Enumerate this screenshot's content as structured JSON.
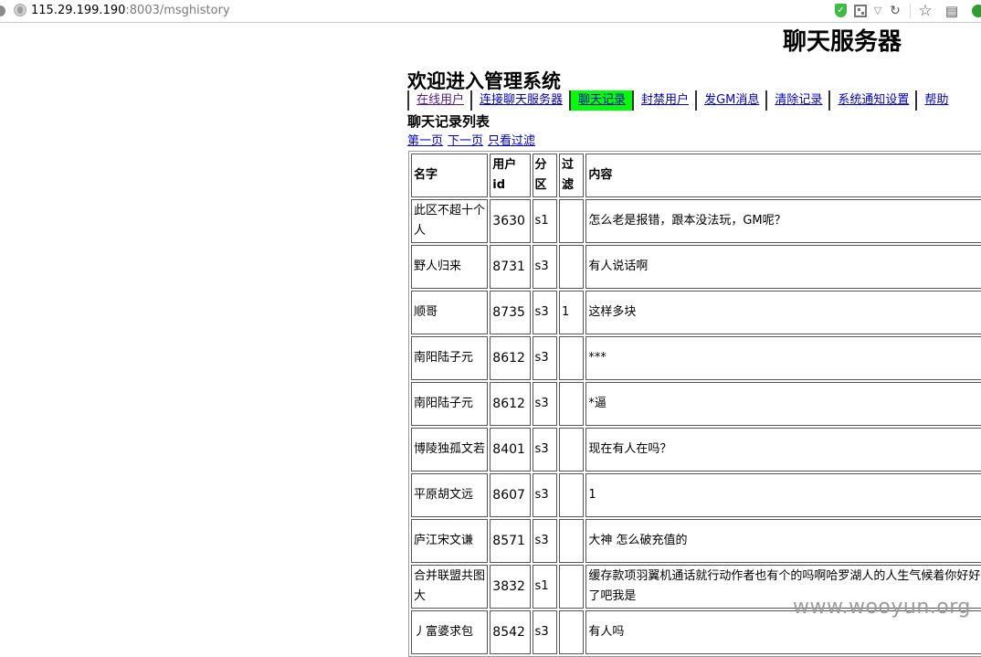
{
  "browser": {
    "url_host": "115.29.199.190",
    "url_path": ":8003/msghistory"
  },
  "page": {
    "server_title": "聊天服务器",
    "welcome": "欢迎进入管理系统",
    "list_title": "聊天记录列表"
  },
  "nav": [
    {
      "label": "在线用户",
      "name": "nav-online-users",
      "state": "visited"
    },
    {
      "label": "连接聊天服务器",
      "name": "nav-connect-server",
      "state": ""
    },
    {
      "label": "聊天记录",
      "name": "nav-chat-history",
      "state": "active"
    },
    {
      "label": "封禁用户",
      "name": "nav-ban-user",
      "state": ""
    },
    {
      "label": "发GM消息",
      "name": "nav-send-gm",
      "state": ""
    },
    {
      "label": "清除记录",
      "name": "nav-clear-records",
      "state": ""
    },
    {
      "label": "系统通知设置",
      "name": "nav-notify-settings",
      "state": ""
    },
    {
      "label": "帮助",
      "name": "nav-help",
      "state": ""
    }
  ],
  "pager": {
    "first": "第一页",
    "next": "下一页",
    "filtered_only": "只看过滤"
  },
  "table": {
    "headers": [
      "名字",
      "用户id",
      "分区",
      "过滤",
      "内容"
    ],
    "rows": [
      {
        "name": "此区不超十个人",
        "uid": "3630",
        "zone": "s1",
        "filter": "",
        "content": "怎么老是报错，跟本没法玩，GM呢？"
      },
      {
        "name": "野人归来",
        "uid": "8731",
        "zone": "s3",
        "filter": "",
        "content": "有人说话啊"
      },
      {
        "name": "顺哥",
        "uid": "8735",
        "zone": "s3",
        "filter": "1",
        "content": "这样多块"
      },
      {
        "name": "南阳陆子元",
        "uid": "8612",
        "zone": "s3",
        "filter": "",
        "content": "***"
      },
      {
        "name": "南阳陆子元",
        "uid": "8612",
        "zone": "s3",
        "filter": "",
        "content": "*逼"
      },
      {
        "name": "博陵独孤文若",
        "uid": "8401",
        "zone": "s3",
        "filter": "",
        "content": "现在有人在吗？"
      },
      {
        "name": "平原胡文远",
        "uid": "8607",
        "zone": "s3",
        "filter": "",
        "content": "1"
      },
      {
        "name": "庐江宋文谦",
        "uid": "8571",
        "zone": "s3",
        "filter": "",
        "content": "大神 怎么破充值的"
      },
      {
        "name": "合并联盟共图大",
        "uid": "3832",
        "zone": "s1",
        "filter": "",
        "content": "缓存款项羽翼机通话就行动作者也有个的吗啊哈罗湖人的人生气候着你好好了吧我是"
      },
      {
        "name": "丿富婆求包",
        "uid": "8542",
        "zone": "s3",
        "filter": "",
        "content": "有人吗"
      }
    ]
  },
  "watermark": "www.wooyun.org"
}
